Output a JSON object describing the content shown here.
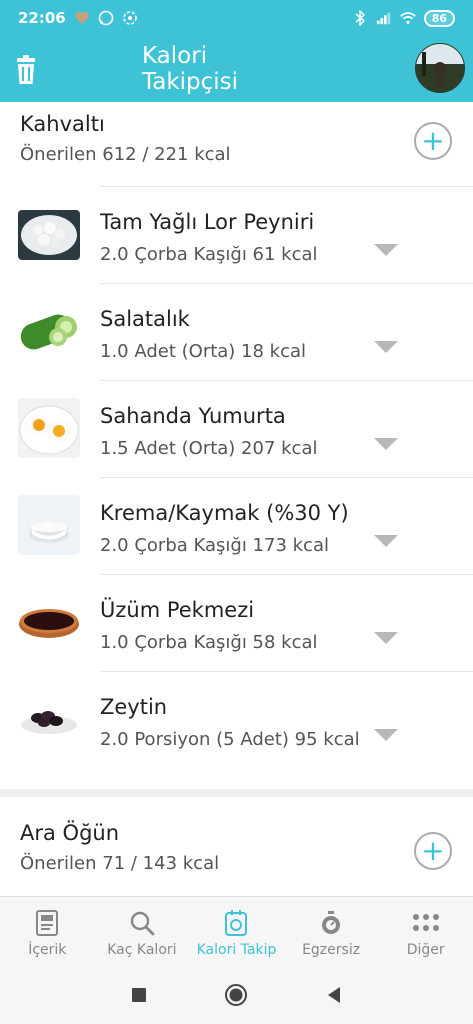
{
  "status": {
    "time": "22:06",
    "battery": "86"
  },
  "app": {
    "title_line1": "Kalori",
    "title_line2": "Takipçisi"
  },
  "breakfast": {
    "title": "Kahvaltı",
    "suggested": "Önerilen 612 / 221 kcal",
    "items": [
      {
        "name": "Tam Yağlı Lor Peyniri",
        "detail": "2.0 Çorba Kaşığı 61 kcal"
      },
      {
        "name": "Salatalık",
        "detail": "1.0 Adet (Orta) 18 kcal"
      },
      {
        "name": "Sahanda Yumurta",
        "detail": "1.5 Adet (Orta) 207 kcal"
      },
      {
        "name": "Krema/Kaymak (%30 Y)",
        "detail": "2.0 Çorba Kaşığı 173 kcal"
      },
      {
        "name": "Üzüm Pekmezi",
        "detail": "1.0 Çorba Kaşığı 58 kcal"
      },
      {
        "name": "Zeytin",
        "detail": "2.0 Porsiyon (5 Adet) 95 kcal"
      }
    ]
  },
  "snack": {
    "title": "Ara Öğün",
    "suggested": "Önerilen 71 / 143 kcal"
  },
  "nav": {
    "items": [
      "İçerik",
      "Kaç Kalori",
      "Kalori Takip",
      "Egzersiz",
      "Diğer"
    ],
    "active": "Kalori Takip"
  },
  "colors": {
    "accent": "#3ec3d6",
    "background": "#ffffff",
    "muted": "#888888"
  }
}
